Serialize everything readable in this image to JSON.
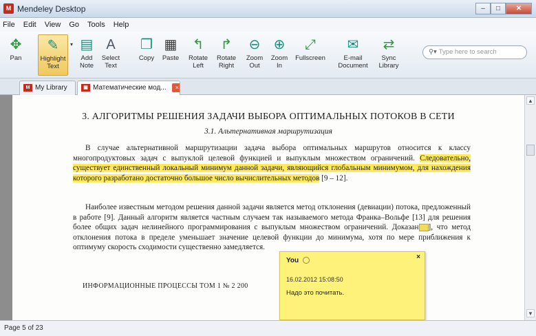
{
  "window": {
    "title": "Mendeley Desktop",
    "app_icon_letters": "M"
  },
  "menu": [
    "File",
    "Edit",
    "View",
    "Go",
    "Tools",
    "Help"
  ],
  "toolbar": {
    "buttons": [
      {
        "label": "Pan",
        "icon": "move-arrows-icon"
      },
      {
        "label": "Highlight\nText",
        "icon": "highlighter-icon",
        "active": true
      },
      {
        "label": "Add\nNote",
        "icon": "note-icon"
      },
      {
        "label": "Select\nText",
        "icon": "text-select-icon"
      },
      {
        "label": "Copy",
        "icon": "copy-icon"
      },
      {
        "label": "Paste",
        "icon": "paste-icon"
      },
      {
        "label": "Rotate\nLeft",
        "icon": "rotate-left-icon"
      },
      {
        "label": "Rotate\nRight",
        "icon": "rotate-right-icon"
      },
      {
        "label": "Zoom\nOut",
        "icon": "zoom-out-icon"
      },
      {
        "label": "Zoom\nIn",
        "icon": "zoom-in-icon"
      },
      {
        "label": "Fullscreen",
        "icon": "fullscreen-icon"
      },
      {
        "label": "E-mail\nDocument",
        "icon": "email-icon"
      },
      {
        "label": "Sync\nLibrary",
        "icon": "sync-icon"
      }
    ],
    "search_placeholder": "Type here to search"
  },
  "tabs": [
    {
      "label": "My Library"
    },
    {
      "label": "Математические мод...",
      "active": true,
      "close": "×"
    }
  ],
  "document": {
    "title": "3. АЛГОРИТМЫ РЕШЕНИЯ ЗАДАЧИ ВЫБОРА ОПТИМАЛЬНЫХ ПОТОКОВ В СЕТИ",
    "subtitle": "3.1. Альтернативная маршрутизация",
    "p1_plain": "В случае альтернативной маршрутизации задача выбора оптимальных маршрутов относится к классу многопродуктовых задач с выпуклой целевой функцией и выпуклым множеством ограничений. ",
    "p1_highlight": "Следовательно, существует единственный локальный минимум данной задачи, являющийся глобальным минимумом, для нахождения которого разработано достаточно большое число вычислительных методов",
    "p1_tail": " [9 – 12].",
    "p2_a": "Наиболее известным методом решения данной задачи является метод отклонения (девиации) потока, предложенный в работе [9]. Данный алгоритм является частным случаем так называемого метода Франка–Вольфе [13] для решения более общих задач нелинейного программирования с выпуклым множеством ограничений. Доказан",
    "p2_b": "], что метод отклонения потока в пределе уменьшает значение целевой функции до минимума, хотя по мере приближения к оптимуму скорость сходимости существенно замедляется.",
    "footer": "ИНФОРМАЦИОННЫЕ ПРОЦЕССЫ   ТОМ 1   № 2   200"
  },
  "note": {
    "author": "You",
    "close": "×",
    "date": "16.02.2012 15:08:50",
    "text": "Надо это почитать."
  },
  "status": {
    "page_text": "Page 5 of 23"
  },
  "colors": {
    "highlight": "#ffe95c",
    "note_bg": "#fff27a",
    "accent_red": "#c42b1c"
  }
}
